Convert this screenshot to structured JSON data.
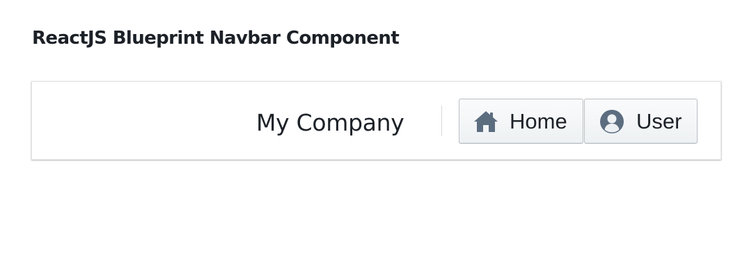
{
  "page": {
    "title": "ReactJS Blueprint Navbar Component"
  },
  "navbar": {
    "brand": "My Company",
    "buttons": [
      {
        "label": "Home",
        "icon": "home-icon"
      },
      {
        "label": "User",
        "icon": "user-icon"
      }
    ]
  },
  "colors": {
    "icon": "#5c6d80",
    "text": "#1c2127",
    "button_border": "#b9bec3"
  }
}
